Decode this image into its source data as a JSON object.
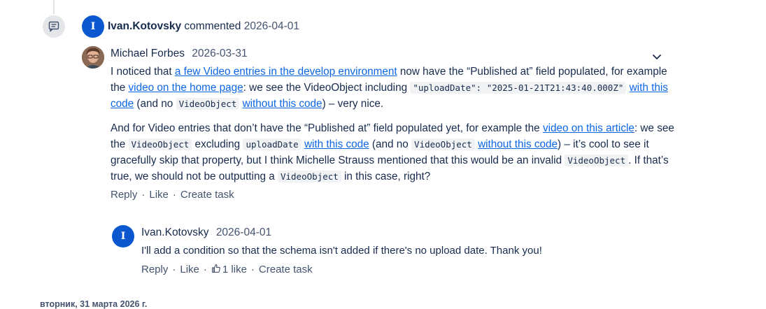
{
  "event": {
    "author": "Ivan.Kotovsky",
    "verb": "commented",
    "date": "2026-04-01",
    "avatar_letter": "I",
    "icon": "comment-icon"
  },
  "comment": {
    "author": "Michael Forbes",
    "date": "2026-03-31",
    "p1": {
      "t1": "I noticed that ",
      "link1": "a few Video entries in the develop environment",
      "t2": " now have the “Published at” field populated, for example the ",
      "link2": "video on the home page",
      "t3": ": we see the VideoObject including ",
      "code1": "\"uploadDate\": \"2025-01-21T21:43:40.000Z\"",
      "t4": " ",
      "link3": "with this code",
      "t5": " (and no ",
      "code2": "VideoObject",
      "t6": " ",
      "link4": "without this code",
      "t7": ") – very nice."
    },
    "p2": {
      "t1": "And for Video entries that don’t have the “Published at” field populated yet, for example the ",
      "link1": "video on this article",
      "t2": ": we see the ",
      "code1": "VideoObject",
      "t3": " excluding ",
      "code2": "uploadDate",
      "t4": " ",
      "link2": "with this code",
      "t5": " (and no ",
      "code3": "VideoObject",
      "t6": " ",
      "link3": "without this code",
      "t7": ") – it’s cool to see it gracefully skip that property, but I think Michelle Strauss mentioned that this would be an invalid ",
      "code4": "VideoObject",
      "t8": ". If that’s true, we should not be outputting a ",
      "code5": "VideoObject",
      "t9": " in this case, right?"
    },
    "actions": {
      "reply": "Reply",
      "like": "Like",
      "create_task": "Create task",
      "sep": "·"
    }
  },
  "reply": {
    "author": "Ivan.Kotovsky",
    "date": "2026-04-01",
    "avatar_letter": "I",
    "text": "I'll add a condition so that the schema isn't added if there's no upload date. Thank you!",
    "actions": {
      "reply": "Reply",
      "like": "Like",
      "like_count": "1 like",
      "create_task": "Create task",
      "sep": "·"
    }
  },
  "day_separator": "вторник, 31 марта 2026 г.",
  "colors": {
    "link": "#0c66e4",
    "avatar_bg": "#0b57d0",
    "text": "#172b4d",
    "muted": "#44546f"
  }
}
